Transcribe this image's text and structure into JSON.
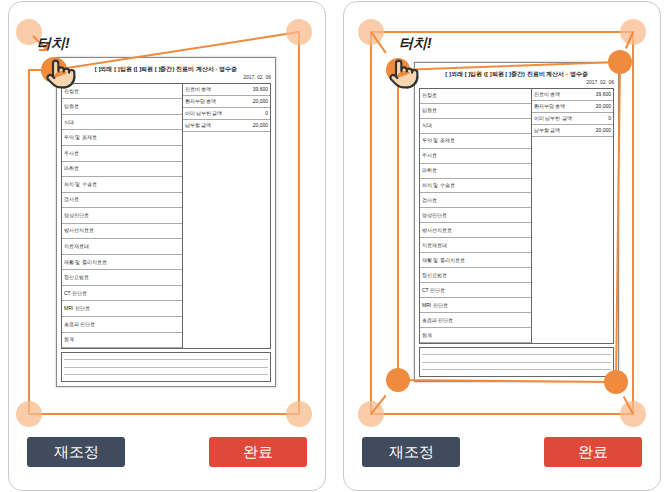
{
  "panels": [
    {
      "kind": "single-corner",
      "touch_label": "터치!",
      "document": {
        "title": "[ ]외래 [ ]입원 ([ ]퇴원 [ ]중간) 진료비 계산서 · 영수증",
        "date": "2017. 02. 06",
        "items": [
          "진찰료",
          "입원료",
          "식대",
          "투약 및 조제료",
          "주사료",
          "마취료",
          "처치 및 수술료",
          "검사료",
          "영상진단료",
          "방사선치료료",
          "치료재료대",
          "재활 및 물리치료료",
          "정신요법료",
          "CT 진단료",
          "MRI 진단료",
          "초음파 진단료",
          "합계"
        ],
        "summary": [
          {
            "label": "진료비 총액",
            "value": "39,600"
          },
          {
            "label": "환자부담 총액",
            "value": "20,000"
          },
          {
            "label": "이미 납부한 금액",
            "value": "0"
          },
          {
            "label": "납부할 금액",
            "value": "20,000"
          }
        ]
      },
      "buttons": [
        {
          "label": "재조정",
          "kind": "secondary"
        },
        {
          "label": "완료",
          "kind": "primary"
        }
      ]
    },
    {
      "kind": "all-corners",
      "touch_label": "터치!",
      "document": {
        "title": "[ ]외래 [ ]입원 ([ ]퇴원 [ ]중간) 진료비 계산서 · 영수증",
        "date": "2017. 02. 06",
        "items": [
          "진찰료",
          "입원료",
          "식대",
          "투약 및 조제료",
          "주사료",
          "마취료",
          "처치 및 수술료",
          "검사료",
          "영상진단료",
          "방사선치료료",
          "치료재료대",
          "재활 및 물리치료료",
          "정신요법료",
          "CT 진단료",
          "MRI 진단료",
          "초음파 진단료",
          "합계"
        ],
        "summary": [
          {
            "label": "진료비 총액",
            "value": "39,600"
          },
          {
            "label": "환자부담 총액",
            "value": "20,000"
          },
          {
            "label": "이미 납부한 금액",
            "value": "0"
          },
          {
            "label": "납부할 금액",
            "value": "20,000"
          }
        ]
      },
      "buttons": [
        {
          "label": "재조정",
          "kind": "secondary"
        },
        {
          "label": "완료",
          "kind": "primary"
        }
      ]
    }
  ]
}
